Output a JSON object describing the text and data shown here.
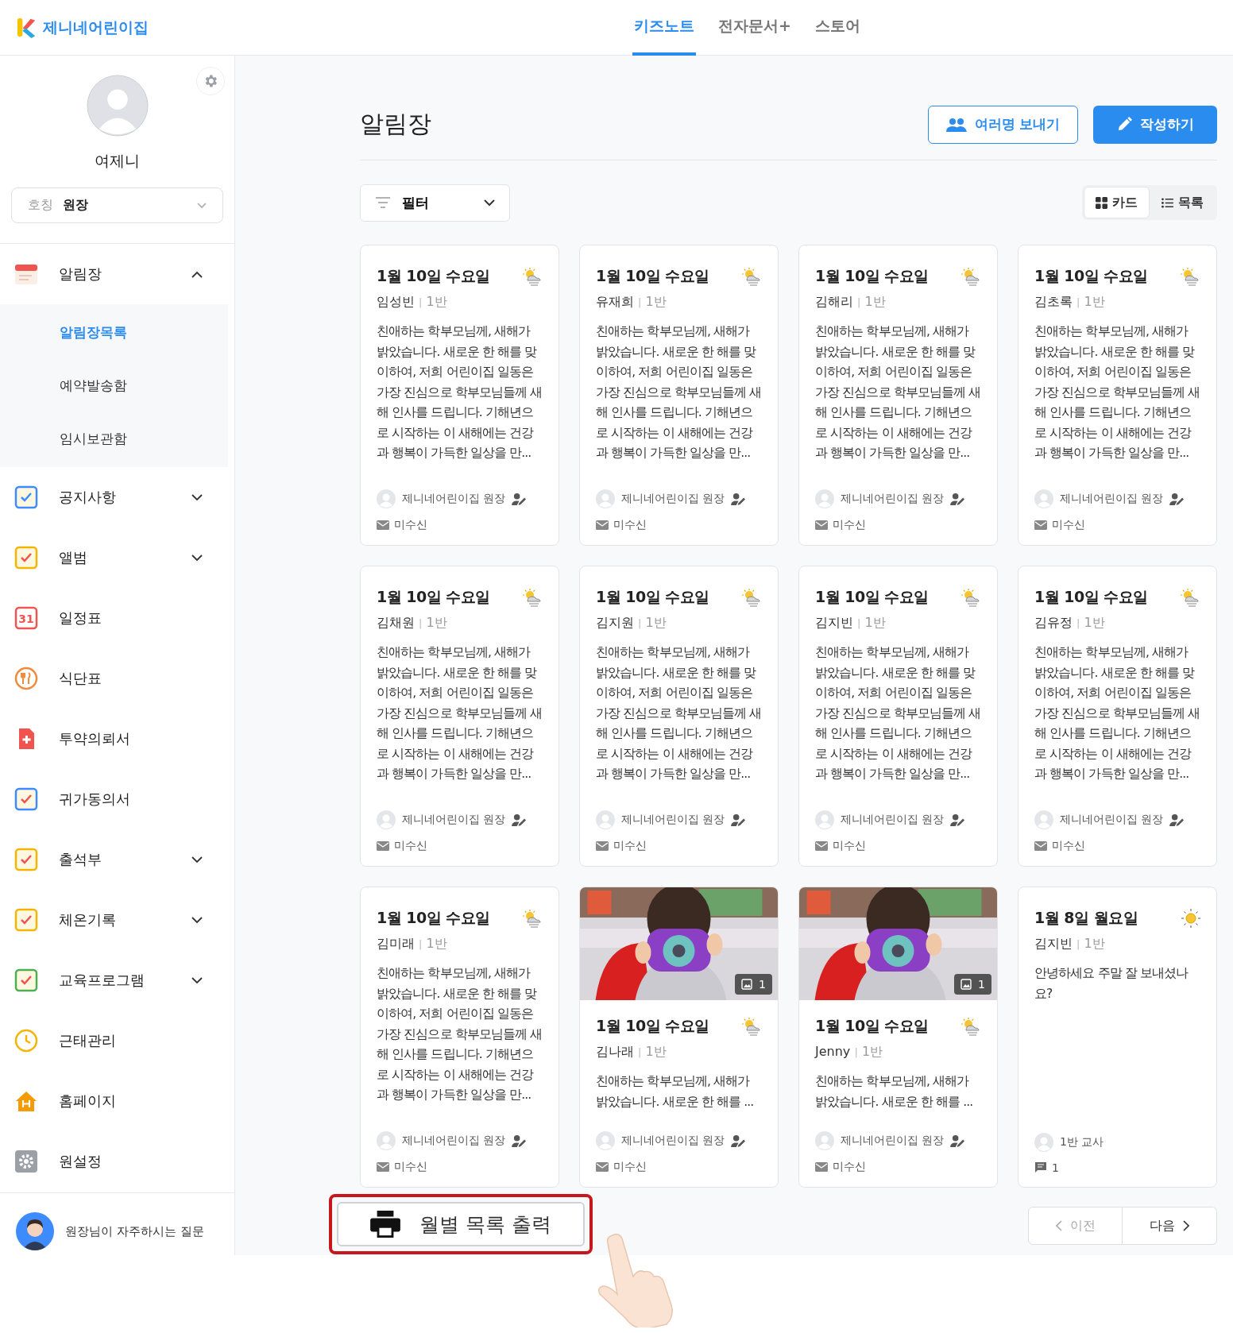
{
  "header": {
    "brand": "제니네어린이집",
    "tabs": [
      {
        "label": "키즈노트",
        "selected": true
      },
      {
        "label": "전자문서+",
        "selected": false
      },
      {
        "label": "스토어",
        "selected": false
      }
    ]
  },
  "sidebar": {
    "profile_name": "여제니",
    "title_field": {
      "label": "호칭",
      "value": "원장"
    },
    "menu": [
      {
        "label": "알림장",
        "kind": "group",
        "expanded": true,
        "children": [
          {
            "label": "알림장목록",
            "selected": true
          },
          {
            "label": "예약발송함",
            "selected": false
          },
          {
            "label": "임시보관함",
            "selected": false
          }
        ]
      },
      {
        "label": "공지사항",
        "kind": "group",
        "expanded": false
      },
      {
        "label": "앨범",
        "kind": "group",
        "expanded": false
      },
      {
        "label": "일정표",
        "kind": "link",
        "icon_text": "31"
      },
      {
        "label": "식단표",
        "kind": "link"
      },
      {
        "label": "투약의뢰서",
        "kind": "link"
      },
      {
        "label": "귀가동의서",
        "kind": "link"
      },
      {
        "label": "출석부",
        "kind": "group",
        "expanded": false
      },
      {
        "label": "체온기록",
        "kind": "group",
        "expanded": false
      },
      {
        "label": "교육프로그램",
        "kind": "group",
        "expanded": false
      },
      {
        "label": "근태관리",
        "kind": "link"
      },
      {
        "label": "홈페이지",
        "kind": "link"
      },
      {
        "label": "원설정",
        "kind": "link"
      }
    ],
    "faq": "원장님이 자주하시는 질문"
  },
  "main": {
    "title": "알림장",
    "buttons": [
      {
        "label": "여러명 보내기",
        "kind": "outline"
      },
      {
        "label": "작성하기",
        "kind": "primary"
      }
    ],
    "filter": "필터",
    "view_toggle": [
      {
        "label": "카드",
        "selected": true
      },
      {
        "label": "목록",
        "selected": false
      }
    ],
    "cards": [
      {
        "kind": "text",
        "date": "1월 10일 수요일",
        "weather": {
          "kind": "partly-cloudy"
        },
        "name": "임성빈",
        "separator": "|",
        "class": "1반",
        "body": "친애하는 학부모님께, 새해가 밝았습니다. 새로운 한 해를 맞이하여, 저희 어린이집 일동은 가장 진심으로 학부모님들께 새해 인사를 드립니다. 기해년으로 시작하는 이 새해에는 건강과 행복이 가득한 일상을 만...",
        "author": "제니네어린이집 원장",
        "author_writer": true,
        "status": {
          "kind": "mail",
          "text": "미수신"
        }
      },
      {
        "kind": "text",
        "date": "1월 10일 수요일",
        "weather": {
          "kind": "partly-cloudy"
        },
        "name": "유재희",
        "separator": "|",
        "class": "1반",
        "body": "친애하는 학부모님께, 새해가 밝았습니다. 새로운 한 해를 맞이하여, 저희 어린이집 일동은 가장 진심으로 학부모님들께 새해 인사를 드립니다. 기해년으로 시작하는 이 새해에는 건강과 행복이 가득한 일상을 만...",
        "author": "제니네어린이집 원장",
        "author_writer": true,
        "status": {
          "kind": "mail",
          "text": "미수신"
        }
      },
      {
        "kind": "text",
        "date": "1월 10일 수요일",
        "weather": {
          "kind": "partly-cloudy"
        },
        "name": "김해리",
        "separator": "|",
        "class": "1반",
        "body": "친애하는 학부모님께, 새해가 밝았습니다. 새로운 한 해를 맞이하여, 저희 어린이집 일동은 가장 진심으로 학부모님들께 새해 인사를 드립니다. 기해년으로 시작하는 이 새해에는 건강과 행복이 가득한 일상을 만...",
        "author": "제니네어린이집 원장",
        "author_writer": true,
        "status": {
          "kind": "mail",
          "text": "미수신"
        }
      },
      {
        "kind": "text",
        "date": "1월 10일 수요일",
        "weather": {
          "kind": "partly-cloudy"
        },
        "name": "김초록",
        "separator": "|",
        "class": "1반",
        "body": "친애하는 학부모님께, 새해가 밝았습니다. 새로운 한 해를 맞이하여, 저희 어린이집 일동은 가장 진심으로 학부모님들께 새해 인사를 드립니다. 기해년으로 시작하는 이 새해에는 건강과 행복이 가득한 일상을 만...",
        "author": "제니네어린이집 원장",
        "author_writer": true,
        "status": {
          "kind": "mail",
          "text": "미수신"
        }
      },
      {
        "kind": "text",
        "date": "1월 10일 수요일",
        "weather": {
          "kind": "partly-cloudy"
        },
        "name": "김채원",
        "separator": "|",
        "class": "1반",
        "body": "친애하는 학부모님께, 새해가 밝았습니다. 새로운 한 해를 맞이하여, 저희 어린이집 일동은 가장 진심으로 학부모님들께 새해 인사를 드립니다. 기해년으로 시작하는 이 새해에는 건강과 행복이 가득한 일상을 만...",
        "author": "제니네어린이집 원장",
        "author_writer": true,
        "status": {
          "kind": "mail",
          "text": "미수신"
        }
      },
      {
        "kind": "text",
        "date": "1월 10일 수요일",
        "weather": {
          "kind": "partly-cloudy"
        },
        "name": "김지원",
        "separator": "|",
        "class": "1반",
        "body": "친애하는 학부모님께, 새해가 밝았습니다. 새로운 한 해를 맞이하여, 저희 어린이집 일동은 가장 진심으로 학부모님들께 새해 인사를 드립니다. 기해년으로 시작하는 이 새해에는 건강과 행복이 가득한 일상을 만...",
        "author": "제니네어린이집 원장",
        "author_writer": true,
        "status": {
          "kind": "mail",
          "text": "미수신"
        }
      },
      {
        "kind": "text",
        "date": "1월 10일 수요일",
        "weather": {
          "kind": "partly-cloudy"
        },
        "name": "김지빈",
        "separator": "|",
        "class": "1반",
        "body": "친애하는 학부모님께, 새해가 밝았습니다. 새로운 한 해를 맞이하여, 저희 어린이집 일동은 가장 진심으로 학부모님들께 새해 인사를 드립니다. 기해년으로 시작하는 이 새해에는 건강과 행복이 가득한 일상을 만...",
        "author": "제니네어린이집 원장",
        "author_writer": true,
        "status": {
          "kind": "mail",
          "text": "미수신"
        }
      },
      {
        "kind": "text",
        "date": "1월 10일 수요일",
        "weather": {
          "kind": "partly-cloudy"
        },
        "name": "김유정",
        "separator": "|",
        "class": "1반",
        "body": "친애하는 학부모님께, 새해가 밝았습니다. 새로운 한 해를 맞이하여, 저희 어린이집 일동은 가장 진심으로 학부모님들께 새해 인사를 드립니다. 기해년으로 시작하는 이 새해에는 건강과 행복이 가득한 일상을 만...",
        "author": "제니네어린이집 원장",
        "author_writer": true,
        "status": {
          "kind": "mail",
          "text": "미수신"
        }
      },
      {
        "kind": "text",
        "date": "1월 10일 수요일",
        "weather": {
          "kind": "partly-cloudy"
        },
        "name": "김미래",
        "separator": "|",
        "class": "1반",
        "body": "친애하는 학부모님께, 새해가 밝았습니다. 새로운 한 해를 맞이하여, 저희 어린이집 일동은 가장 진심으로 학부모님들께 새해 인사를 드립니다. 기해년으로 시작하는 이 새해에는 건강과 행복이 가득한 일상을 만...",
        "author": "제니네어린이집 원장",
        "author_writer": true,
        "status": {
          "kind": "mail",
          "text": "미수신"
        }
      },
      {
        "photo_count": "1",
        "date": "1월 10일 수요일",
        "weather": {
          "kind": "partly-cloudy"
        },
        "name": "김나래",
        "separator": "|",
        "class": "1반",
        "body": "친애하는 학부모님께, 새해가 밝았습니다. 새로운 한 해를 ...",
        "author": "제니네어린이집 원장",
        "author_writer": true,
        "status": {
          "kind": "mail",
          "text": "미수신"
        }
      },
      {
        "photo_count": "1",
        "date": "1월 10일 수요일",
        "weather": {
          "kind": "partly-cloudy"
        },
        "name": "Jenny",
        "separator": "|",
        "class": "1반",
        "body": "친애하는 학부모님께, 새해가 밝았습니다. 새로운 한 해를 ...",
        "author": "제니네어린이집 원장",
        "author_writer": true,
        "status": {
          "kind": "mail",
          "text": "미수신"
        }
      },
      {
        "kind": "text",
        "date": "1월 8일 월요일",
        "weather": {
          "kind": "sunny"
        },
        "name": "김지빈",
        "separator": "|",
        "class": "1반",
        "body": "안녕하세요 주말 잘 보내셨나요?",
        "author": "1반 교사",
        "author_writer": false,
        "status": {
          "kind": "comment",
          "text": "1"
        }
      }
    ],
    "print_button": {
      "label": "월별 목록 출력",
      "highlighted": true
    },
    "pagination": {
      "prev": "이전",
      "next": "다음",
      "prev_disabled": true
    }
  }
}
